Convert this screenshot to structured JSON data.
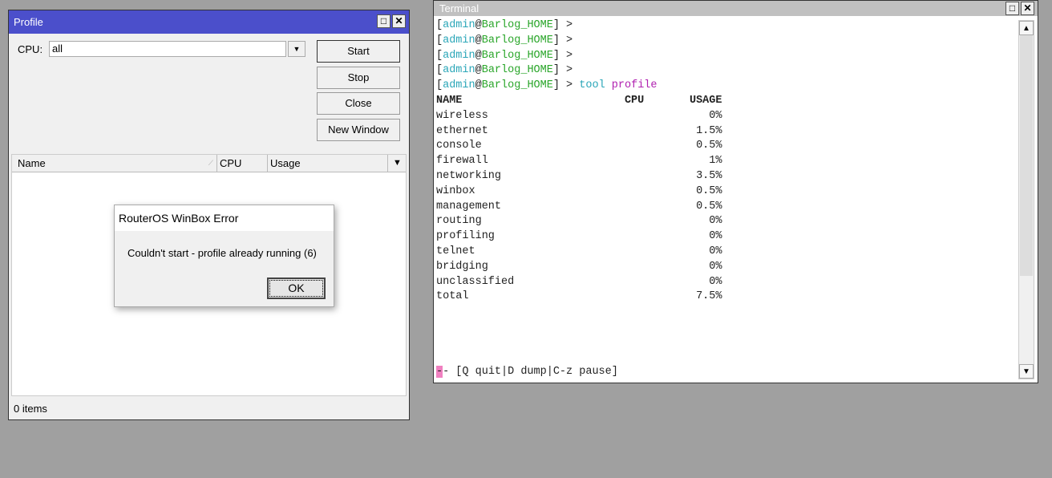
{
  "profile_window": {
    "title": "Profile",
    "cpu_label": "CPU:",
    "cpu_value": "all",
    "buttons": {
      "start": "Start",
      "stop": "Stop",
      "close": "Close",
      "new_window": "New Window"
    },
    "columns": [
      "Name",
      "CPU",
      "Usage"
    ],
    "status": "0 items"
  },
  "terminal": {
    "title": "Terminal",
    "prompt_user": "admin",
    "prompt_at": "@",
    "prompt_host": "Barlog_HOME",
    "prompt_open": "[",
    "prompt_close": "] >",
    "command_1": "tool",
    "command_2": "profile",
    "headers": {
      "name": "NAME",
      "cpu": "CPU",
      "usage": "USAGE"
    },
    "rows": [
      {
        "name": "wireless",
        "usage": "0%"
      },
      {
        "name": "ethernet",
        "usage": "1.5%"
      },
      {
        "name": "console",
        "usage": "0.5%"
      },
      {
        "name": "firewall",
        "usage": "1%"
      },
      {
        "name": "networking",
        "usage": "3.5%"
      },
      {
        "name": "winbox",
        "usage": "0.5%"
      },
      {
        "name": "management",
        "usage": "0.5%"
      },
      {
        "name": "routing",
        "usage": "0%"
      },
      {
        "name": "profiling",
        "usage": "0%"
      },
      {
        "name": "telnet",
        "usage": "0%"
      },
      {
        "name": "bridging",
        "usage": "0%"
      },
      {
        "name": "unclassified",
        "usage": "0%"
      },
      {
        "name": "total",
        "usage": "7.5%"
      }
    ],
    "footer": "- [Q quit|D dump|C-z pause]"
  },
  "dialog": {
    "title": "RouterOS WinBox Error",
    "message": "Couldn't start - profile already running (6)",
    "ok": "OK"
  }
}
